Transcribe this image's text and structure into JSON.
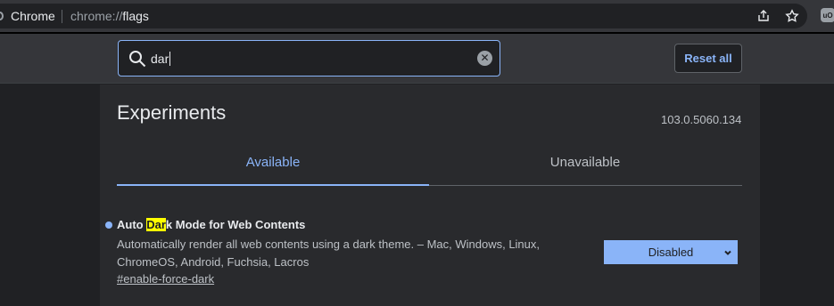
{
  "browser": {
    "chip_label": "Chrome",
    "url_scheme": "chrome://",
    "url_host": "flags",
    "icons": [
      "share-icon",
      "bookmark-star-icon",
      "extension-icon"
    ]
  },
  "header": {
    "search": {
      "value": "dar",
      "icon": "search-icon",
      "clear_icon": "clear-icon"
    },
    "reset_label": "Reset all"
  },
  "page": {
    "title": "Experiments",
    "version": "103.0.5060.134",
    "tabs": [
      {
        "label": "Available",
        "active": true
      },
      {
        "label": "Unavailable",
        "active": false
      }
    ]
  },
  "flags": [
    {
      "title_before": "Auto ",
      "title_highlight": "Dar",
      "title_after": "k Mode for Web Contents",
      "description_line1": "Automatically render all web contents using a dark theme. – Mac, Windows, Linux,",
      "description_line2": "ChromeOS, Android, Fuchsia, Lacros",
      "link": "#enable-force-dark",
      "state": "Disabled"
    }
  ],
  "colors": {
    "accent": "#8ab4f8",
    "background": "#202124",
    "header": "#35363a",
    "highlight": "#ffff00"
  }
}
